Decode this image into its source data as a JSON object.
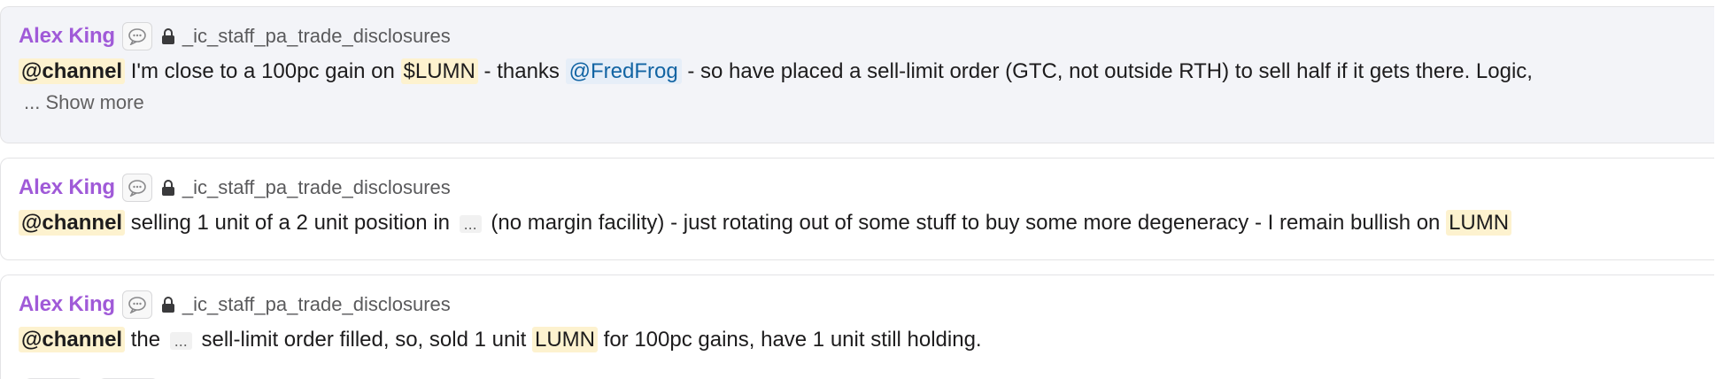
{
  "results": [
    {
      "author": "Alex King",
      "channel": "_ic_staff_pa_trade_disclosures",
      "mention": "@channel",
      "text_a": " I'm close to a 100pc gain on ",
      "ticker": "$LUMN",
      "text_b": " - thanks ",
      "user_mention": "@FredFrog",
      "text_c": " - so have placed a sell-limit order (GTC, not outside RTH) to sell half if it gets there.  Logic,",
      "show_more": "... Show more"
    },
    {
      "author": "Alex King",
      "channel": "_ic_staff_pa_trade_disclosures",
      "mention": "@channel",
      "text_a": " selling 1 unit of a 2 unit position in ",
      "ellipsis": "...",
      "text_b": " (no margin facility) - just rotating out of some stuff to buy some more degeneracy - I remain bullish on ",
      "ticker": "LUMN"
    },
    {
      "author": "Alex King",
      "channel": "_ic_staff_pa_trade_disclosures",
      "mention": "@channel",
      "text_a": " the ",
      "ellipsis": "...",
      "text_b": " sell-limit order filled, so, sold 1 unit ",
      "ticker": "LUMN",
      "text_c": " for 100pc gains, have 1 unit still holding."
    }
  ],
  "icons": {
    "thread": "speech-bubble-icon",
    "private_channel": "lock-icon"
  },
  "colors": {
    "author": "#a05ad8",
    "mention_bg": "#fdf2cf",
    "user_mention": "#1264a3",
    "highlight_bg": "#f3f4f8"
  }
}
